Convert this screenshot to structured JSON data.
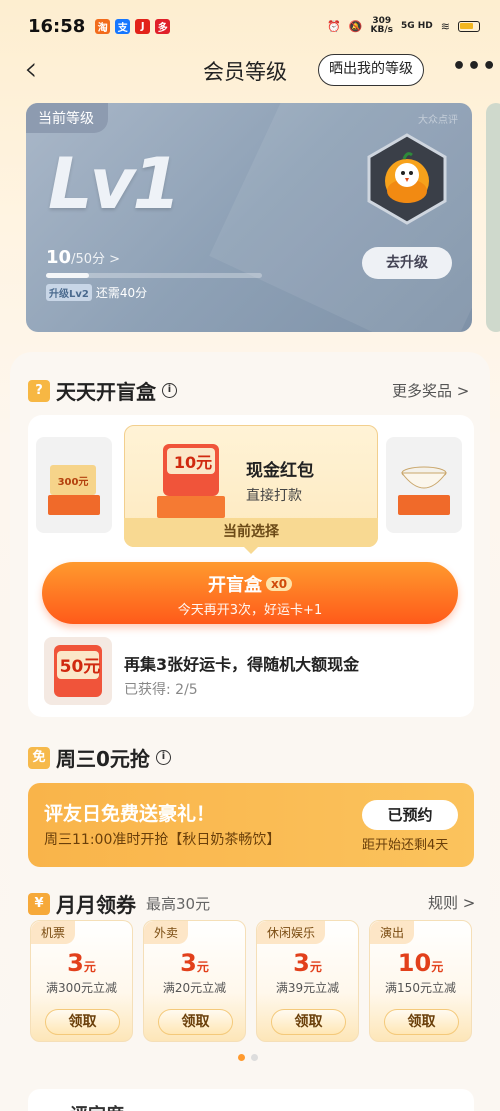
{
  "statusbar": {
    "time": "16:58",
    "speed": "309",
    "speed_unit": "KB/s",
    "network": "5G HD"
  },
  "header": {
    "title": "会员等级",
    "share_label": "晒出我的等级"
  },
  "level_card": {
    "tag": "当前等级",
    "brand": "大众点评",
    "level": "Lv1",
    "points": "10",
    "points_total": "/50分 >",
    "progress": 0.2,
    "next_badge": "升级Lv2",
    "next_text": "还需40分",
    "upgrade_label": "去升级"
  },
  "blind_box": {
    "title": "天天开盲盒",
    "more_label": "更多奖品 >",
    "left_prize": "300元",
    "center_badge": "10元",
    "prize_title": "现金红包",
    "prize_sub": "直接打款",
    "current_label": "当前选择",
    "open_label": "开盲盒",
    "open_count": "x0",
    "open_sub": "今天再开3次，好运卡+1",
    "luck_badge": "50元",
    "luck_title": "再集3张好运卡，得随机大额现金",
    "luck_sub": "已获得: 2/5"
  },
  "wednesday": {
    "icon": "免",
    "title": "周三0元抢",
    "card_title": "评友日免费送豪礼！",
    "card_sub": "周三11:00准时开抢【秋日奶茶畅饮】",
    "btn_label": "已预约",
    "countdown": "距开始还剩4天"
  },
  "coupons": {
    "icon": "¥",
    "title": "月月领券",
    "subtitle": "最高30元",
    "rules_label": "规则 >",
    "items": [
      {
        "tag": "机票",
        "value": "3",
        "unit": "元",
        "cond": "满300元立减",
        "btn": "领取"
      },
      {
        "tag": "外卖",
        "value": "3",
        "unit": "元",
        "cond": "满20元立减",
        "btn": "领取"
      },
      {
        "tag": "休闲娱乐",
        "value": "3",
        "unit": "元",
        "cond": "满39元立减",
        "btn": "领取"
      },
      {
        "tag": "演出",
        "value": "10",
        "unit": "元",
        "cond": "满150元立减",
        "btn": "领取"
      }
    ]
  },
  "bottom": {
    "title": "评定度"
  },
  "colors": {
    "accent": "#ff5a1a",
    "gold": "#f9b44a",
    "card_grey": "#8ea1b6"
  }
}
